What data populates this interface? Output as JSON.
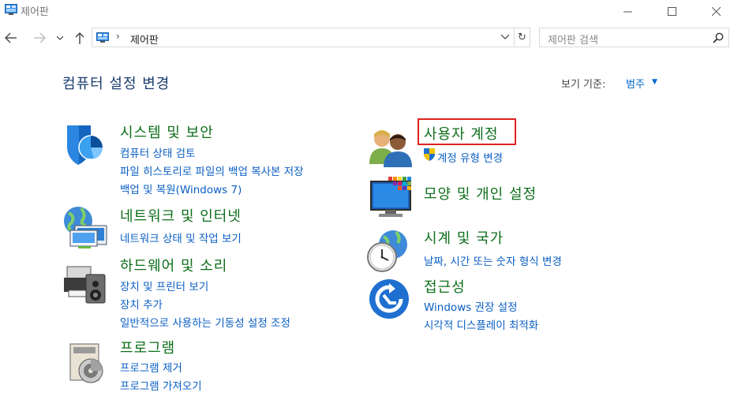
{
  "window": {
    "title": "제어판"
  },
  "nav": {
    "address_path": "제어판",
    "search_placeholder": "제어판 검색"
  },
  "header": {
    "page_title": "컴퓨터 설정 변경",
    "view_by_label": "보기 기준:",
    "view_by_value": "범주"
  },
  "left_column": [
    {
      "title": "시스템 및 보안",
      "icon": "security-shield-icon",
      "links": [
        "컴퓨터 상태 검토",
        "파일 히스토리로 파일의 백업 복사본 저장",
        "백업 및 복원(Windows 7)"
      ]
    },
    {
      "title": "네트워크 및 인터넷",
      "icon": "network-globe-icon",
      "links": [
        "네트워크 상태 및 작업 보기"
      ]
    },
    {
      "title": "하드웨어 및 소리",
      "icon": "printer-speaker-icon",
      "links": [
        "장치 및 프린터 보기",
        "장치 추가",
        "일반적으로 사용하는 기동성 설정 조정"
      ]
    },
    {
      "title": "프로그램",
      "icon": "program-disc-icon",
      "links": [
        "프로그램 제거",
        "프로그램 가져오기"
      ]
    }
  ],
  "right_column": [
    {
      "title": "사용자 계정",
      "icon": "users-icon",
      "links": [
        "계정 유형 변경"
      ],
      "highlighted": true
    },
    {
      "title": "모양 및 개인 설정",
      "icon": "appearance-monitor-icon",
      "links": []
    },
    {
      "title": "시계 및 국가",
      "icon": "clock-globe-icon",
      "links": [
        "날짜, 시간 또는 숫자 형식 변경"
      ]
    },
    {
      "title": "접근성",
      "icon": "accessibility-icon",
      "links": [
        "Windows 권장 설정",
        "시각적 디스플레이 최적화"
      ]
    }
  ],
  "colors": {
    "category_title": "#0e6e1a",
    "link": "#0b5fc4",
    "highlight_border": "#e02020"
  }
}
